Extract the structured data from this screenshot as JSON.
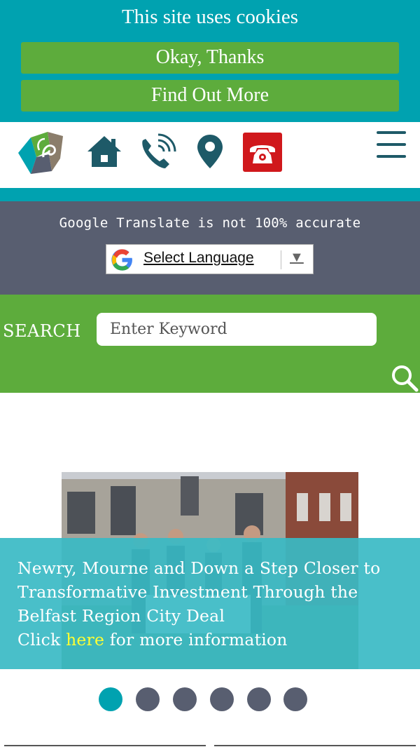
{
  "cookie_banner": {
    "title": "This site uses cookies",
    "accept_label": "Okay, Thanks",
    "more_label": "Find Out More"
  },
  "header": {
    "icons": [
      "logo",
      "home-icon",
      "phone-icon",
      "location-pin-icon",
      "emergency-phone-icon",
      "hamburger-menu-icon"
    ]
  },
  "translate": {
    "note": "Google Translate is not 100% accurate",
    "select_label": "Select Language",
    "arrow": "▼"
  },
  "search": {
    "label": "SEARCH",
    "placeholder": "Enter Keyword"
  },
  "hero": {
    "headline": "Newry, Mourne and Down a Step Closer to Transformative Investment Through the Belfast Region City Deal",
    "click_prefix": "Click ",
    "link_label": "here",
    "click_suffix": " for more information"
  },
  "carousel": {
    "slide_count": 6,
    "active_index": 0
  },
  "colors": {
    "teal": "#00a2b0",
    "green": "#5dac3c",
    "slate": "#585e70",
    "dark_teal": "#1e5a68",
    "emergency_red": "#d0181c",
    "link_yellow": "#ffff33"
  }
}
